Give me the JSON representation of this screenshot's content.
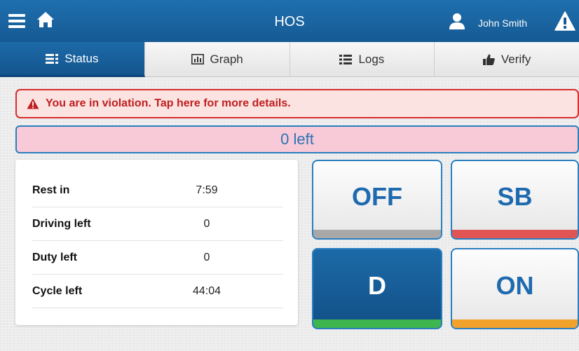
{
  "header": {
    "title": "HOS",
    "user_name": "John Smith",
    "icons": [
      "menu-icon",
      "home-icon",
      "user-icon",
      "warning-icon"
    ]
  },
  "tabs": [
    {
      "label": "Status",
      "icon": "status-icon",
      "active": true
    },
    {
      "label": "Graph",
      "icon": "graph-icon",
      "active": false
    },
    {
      "label": "Logs",
      "icon": "logs-icon",
      "active": false
    },
    {
      "label": "Verify",
      "icon": "thumbs-up-icon",
      "active": false
    }
  ],
  "violation": {
    "text": "You are in violation. Tap here for more details.",
    "icon": "warning-icon",
    "color": "#c01f1f"
  },
  "time_left": {
    "text": "0 left"
  },
  "status": {
    "rows": [
      {
        "label": "Rest in",
        "value": "7:59"
      },
      {
        "label": "Driving left",
        "value": "0"
      },
      {
        "label": "Duty left",
        "value": "0"
      },
      {
        "label": "Cycle left",
        "value": "44:04"
      }
    ]
  },
  "duty_buttons": {
    "off": {
      "label": "OFF",
      "selected": false,
      "color": "#a8a8a8"
    },
    "sb": {
      "label": "SB",
      "selected": false,
      "color": "#e05454"
    },
    "d": {
      "label": "D",
      "selected": true,
      "color": "#3fb54f"
    },
    "on": {
      "label": "ON",
      "selected": false,
      "color": "#f2a12a"
    }
  },
  "colors": {
    "primary": "#1a64a3",
    "violation_bg": "#fbe3e2",
    "time_left_bg": "#f8c9d6"
  }
}
